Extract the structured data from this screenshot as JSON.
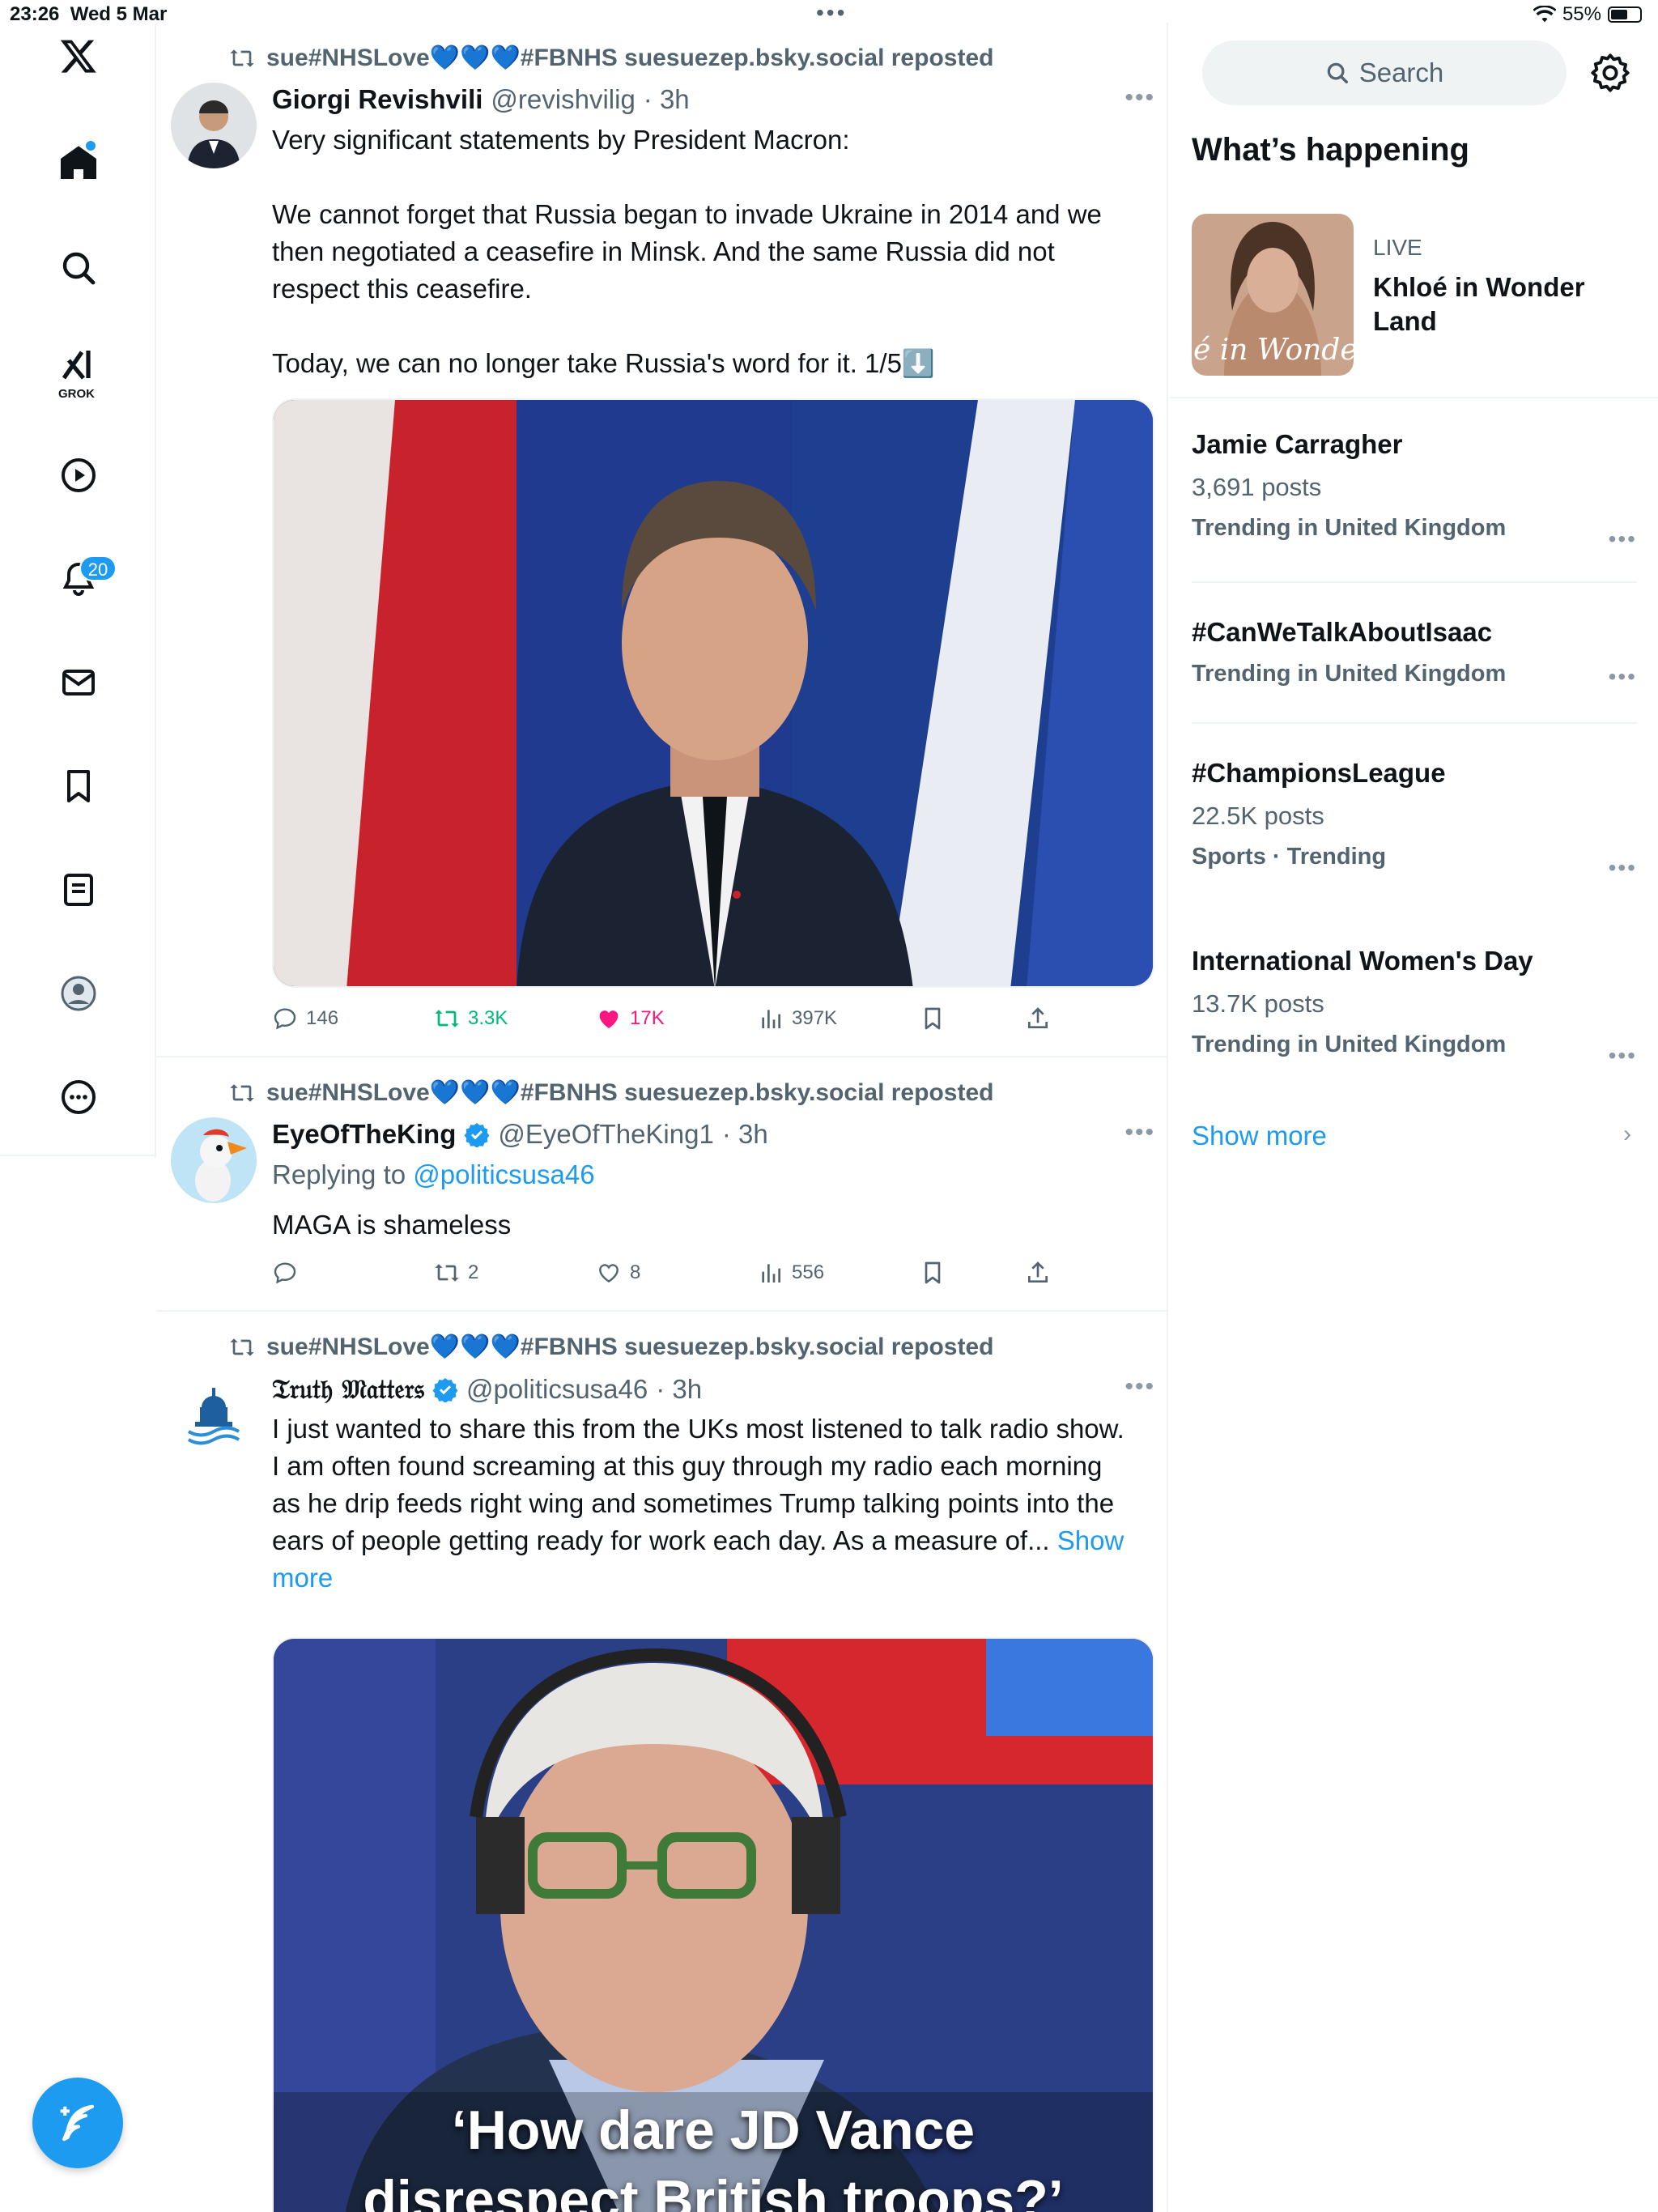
{
  "status_bar": {
    "time": "23:26",
    "date": "Wed 5 Mar",
    "battery": "55%"
  },
  "nav": {
    "items": [
      "x-logo-icon",
      "home-icon",
      "search-icon",
      "grok-icon",
      "video-icon",
      "notifications-icon",
      "messages-icon",
      "bookmarks-icon",
      "lists-icon",
      "profile-icon",
      "more-icon"
    ],
    "grok_label": "GROK",
    "notifications_count": "20"
  },
  "posts": [
    {
      "repost_by": "sue#NHSLove💙💙💙#FBNHS suesuezep.bsky.social reposted",
      "author": "Giorgi Revishvili",
      "handle": "@revishvilig",
      "time": "· 3h",
      "text": "Very significant statements by President Macron:\n\nWe cannot forget that Russia began to invade Ukraine in 2014 and we then negotiated a ceasefire in Minsk. And the same Russia did not respect this ceasefire.\n\nToday, we can no longer take Russia's word for it. 1/5⬇️",
      "stats": {
        "replies": "146",
        "reposts": "3.3K",
        "likes": "17K",
        "views": "397K"
      }
    },
    {
      "repost_by": "sue#NHSLove💙💙💙#FBNHS suesuezep.bsky.social reposted",
      "author": "EyeOfTheKing",
      "handle": "@EyeOfTheKing1",
      "time": "· 3h",
      "replying_prefix": "Replying to",
      "replying_to": "@politicsusa46",
      "text": "MAGA is shameless",
      "stats": {
        "replies": "",
        "reposts": "2",
        "likes": "8",
        "views": "556"
      }
    },
    {
      "repost_by": "sue#NHSLove💙💙💙#FBNHS suesuezep.bsky.social reposted",
      "author": "𝔗𝔯𝔲𝔱𝔥 𝔐𝔞𝔱𝔱𝔢𝔯𝔰",
      "handle": "@politicsusa46",
      "time": "· 3h",
      "text": "I just wanted to share this from the UKs most listened to talk radio show. I am often found screaming at this guy through my radio each morning as he drip feeds right wing and sometimes Trump talking points into the ears of people getting ready for work each day. As a measure of...",
      "show_more": "Show more",
      "media_caption_line1": "‘How dare JD Vance",
      "media_caption_line2": "disrespect British troops?’"
    }
  ],
  "sidebar": {
    "search_placeholder": "Search",
    "title": "What’s happening",
    "live": {
      "label": "LIVE",
      "title": "Khloé in Wonder Land",
      "thumb_text": "é in Wonder L"
    },
    "trends": [
      {
        "title": "Jamie Carragher",
        "count": "3,691 posts",
        "context": "Trending in United Kingdom"
      },
      {
        "title": "#CanWeTalkAboutIsaac",
        "count": "",
        "context": "Trending in United Kingdom"
      },
      {
        "title": "#ChampionsLeague",
        "count": "22.5K posts",
        "context": "Sports · Trending"
      },
      {
        "title": "International Women's Day",
        "count": "13.7K posts",
        "context": "Trending in United Kingdom"
      }
    ],
    "show_more": "Show more"
  },
  "colors": {
    "accent": "#1d9bf0",
    "like": "#f91880",
    "repost": "#00ba7c",
    "secondary_text": "#536471"
  }
}
